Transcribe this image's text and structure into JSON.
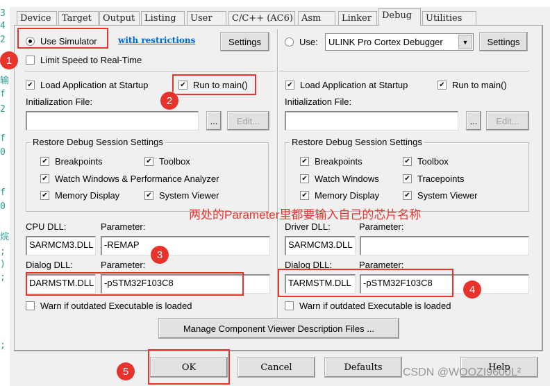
{
  "code_gutter": [
    "3",
    "4",
    "2",
    "输",
    "f",
    "2",
    "f",
    "0",
    "f",
    "0",
    "烷",
    ";",
    ")",
    ";",
    ";"
  ],
  "tabs": [
    {
      "label": "Device"
    },
    {
      "label": "Target"
    },
    {
      "label": "Output"
    },
    {
      "label": "Listing"
    },
    {
      "label": "User"
    },
    {
      "label": "C/C++ (AC6)"
    },
    {
      "label": "Asm"
    },
    {
      "label": "Linker"
    },
    {
      "label": "Debug",
      "selected": true
    },
    {
      "label": "Utilities"
    }
  ],
  "left": {
    "use_simulator": "Use Simulator",
    "use_simulator_checked": true,
    "with_restrictions": "with restrictions",
    "settings": "Settings",
    "limit_speed": "Limit Speed to Real-Time",
    "limit_speed_checked": false,
    "load_app": "Load Application at Startup",
    "load_app_checked": true,
    "run_to_main": "Run to main()",
    "run_to_main_checked": true,
    "init_file_label": "Initialization File:",
    "init_file_value": "",
    "browse": "...",
    "edit": "Edit...",
    "restore_title": "Restore Debug Session Settings",
    "restore_items": [
      {
        "label": "Breakpoints",
        "checked": true
      },
      {
        "label": "Toolbox",
        "checked": true
      },
      {
        "label": "Watch Windows & Performance Analyzer",
        "checked": true
      },
      {
        "label": "Memory Display",
        "checked": true
      },
      {
        "label": "System Viewer",
        "checked": true
      }
    ],
    "cpu_dll_label": "CPU DLL:",
    "cpu_param_label": "Parameter:",
    "cpu_dll": "SARMCM3.DLL",
    "cpu_param": "-REMAP",
    "dialog_dll_label": "Dialog DLL:",
    "dialog_param_label": "Parameter:",
    "dialog_dll": "DARMSTM.DLL",
    "dialog_param": "-pSTM32F103C8",
    "warn": "Warn if outdated Executable is loaded",
    "warn_checked": false
  },
  "right": {
    "use": "Use:",
    "use_checked": false,
    "debugger": "ULINK Pro Cortex Debugger",
    "settings": "Settings",
    "load_app": "Load Application at Startup",
    "load_app_checked": true,
    "run_to_main": "Run to main()",
    "run_to_main_checked": true,
    "init_file_label": "Initialization File:",
    "init_file_value": "",
    "browse": "...",
    "edit": "Edit...",
    "restore_title": "Restore Debug Session Settings",
    "restore_items": [
      {
        "label": "Breakpoints",
        "checked": true
      },
      {
        "label": "Toolbox",
        "checked": true
      },
      {
        "label": "Watch Windows",
        "checked": true
      },
      {
        "label": "Tracepoints",
        "checked": true
      },
      {
        "label": "Memory Display",
        "checked": true
      },
      {
        "label": "System Viewer",
        "checked": true
      }
    ],
    "driver_dll_label": "Driver DLL:",
    "driver_param_label": "Parameter:",
    "driver_dll": "SARMCM3.DLL",
    "driver_param": "",
    "dialog_dll_label": "Dialog DLL:",
    "dialog_param_label": "Parameter:",
    "dialog_dll": "TARMSTM.DLL",
    "dialog_param": "-pSTM32F103C8",
    "warn": "Warn if outdated Executable is loaded",
    "warn_checked": false
  },
  "manage_button": "Manage Component Viewer Description Files ...",
  "footer": {
    "ok": "OK",
    "cancel": "Cancel",
    "defaults": "Defaults",
    "help": "Help"
  },
  "annotations": {
    "note": "两处的Parameter里都要输入自己的芯片名称",
    "badges": [
      "1",
      "2",
      "3",
      "4",
      "5"
    ],
    "color": "#e8332d"
  },
  "watermark": "CSDN @WOOZI9600L²"
}
